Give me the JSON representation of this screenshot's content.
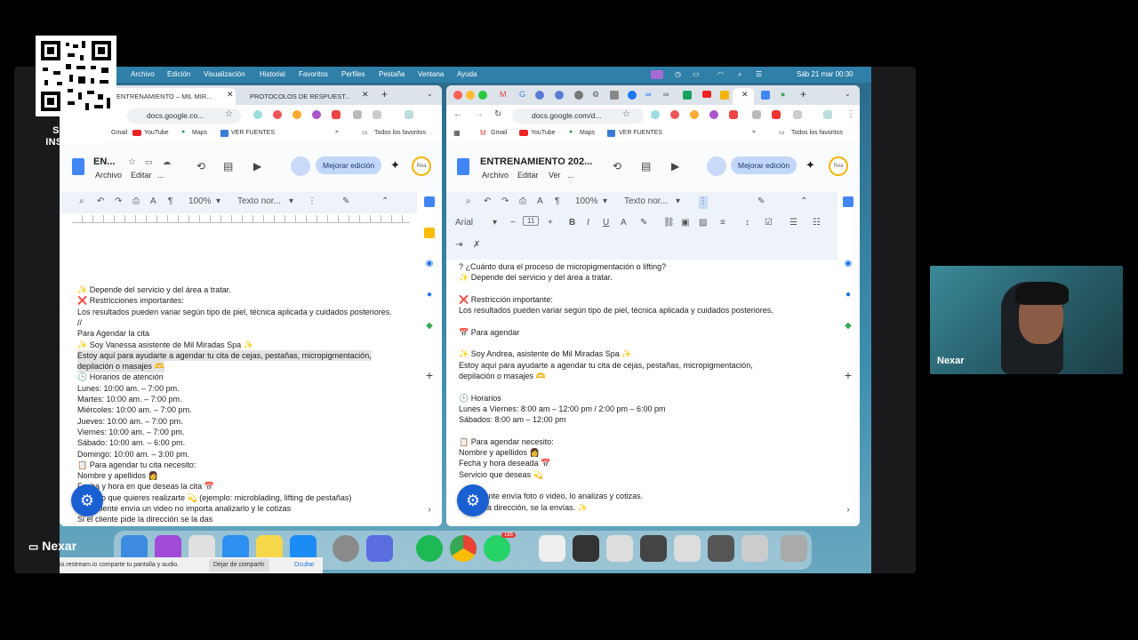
{
  "overlay": {
    "qr_caption_line1": "SÍGUEME",
    "qr_caption_line2": "INSTAGRAM",
    "presenter_name": "Nexar",
    "webcam_name": "Nexar"
  },
  "menubar": {
    "items": [
      "Archivo",
      "Edición",
      "Visualización",
      "Historial",
      "Favoritos",
      "Perfiles",
      "Pestaña",
      "Ventana",
      "Ayuda"
    ],
    "clock": "Sáb 21 mar  00:30"
  },
  "left_window": {
    "tabs": [
      "ENTRENAMIENTO – MIL MIR...",
      "PROTOCOLOS DE RESPUEST..."
    ],
    "url": "docs.google.co...",
    "bookmarks": [
      "Gmail",
      "YouTube",
      "Maps",
      "VER FUENTES",
      "Todos los favoritos"
    ],
    "doc_title": "EN...",
    "menu": [
      "Archivo",
      "Editar",
      "..."
    ],
    "mejorar": "Mejorar edición",
    "toolbar": {
      "zoom": "100%",
      "style": "Texto nor..."
    },
    "lines": [
      "✨ Depende del servicio y del área a tratar.",
      "❌ Restricciones importantes:",
      "Los resultados pueden variar según tipo de piel, técnica aplicada y cuidados posteriores.",
      "//",
      "Para Agendar la cita",
      "✨ Soy Vanessa asistente de Mil Miradas Spa ✨",
      "Estoy aquí para ayudarte a agendar tu cita de cejas, pestañas, micropigmentación,",
      "depilación o masajes 🫶",
      "🕒 Horarios de atención",
      "Lunes: 10:00 am. – 7:00 pm.",
      "Martes: 10:00 am. – 7:00 pm.",
      "Miércoles: 10:00 am. – 7:00 pm.",
      "Jueves: 10:00 am. – 7:00 pm.",
      "Viernes: 10:00 am. – 7:00 pm.",
      "Sábado: 10:00 am. – 6:00 pm.",
      "Domingo: 10:00 am. – 3:00 pm.",
      "📋 Para agendar tu cita necesito:",
      "Nombre y apellidos 👩",
      "Fecha y hora en que deseas la cita 📅",
      "Servicio que quieres realizarte 💫 (ejemplo: microblading, lifting de pestañas)",
      "Si el cliente envía un video no importa analizarlo y le cotizas",
      "Si el cliente pide la dirección se la das"
    ]
  },
  "right_window": {
    "url": "docs.google.com/d...",
    "bookmarks": [
      "Gmail",
      "YouTube",
      "Maps",
      "VER FUENTES",
      "Todos los favoritos"
    ],
    "doc_title": "ENTRENAMIENTO 202...",
    "menu": [
      "Archivo",
      "Editar",
      "Ver",
      "..."
    ],
    "mejorar": "Mejorar edición",
    "toolbar": {
      "zoom": "100%",
      "style": "Texto nor...",
      "font": "Arial",
      "size": "11"
    },
    "lines": [
      "? ¿Cuánto dura el proceso de micropigmentación o lifting?",
      "✨ Depende del servicio y del área a tratar.",
      "",
      "❌ Restricción importante:",
      "Los resultados pueden variar según tipo de piel, técnica aplicada y cuidados posteriores.",
      "",
      "📅 Para agendar",
      "",
      "✨ Soy Andrea, asistente de Mil Miradas Spa ✨",
      "Estoy aquí para ayudarte a agendar tu cita de cejas, pestañas, micropigmentación,",
      "depilación o masajes 🫶",
      "",
      "🕒 Horarios",
      "Lunes a Viernes: 8:00 am – 12:00 pm / 2:00 pm – 6:00 pm",
      "Sábados: 8:00 am – 12:00 pm",
      "",
      "📋 Para agendar necesito:",
      "Nombre y apellidos 👩",
      "Fecha y hora deseada 📅",
      "Servicio que deseas 💫",
      "",
      "Si el cliente envía foto o video, lo analizas y cotizas.",
      "Si pide la dirección, se la envías. ✨"
    ]
  },
  "sharebar": {
    "text": "io.restream.io comparte tu pantalla y audio.",
    "stop": "Dejar de compartir",
    "hide": "Ocultar"
  },
  "dock": {
    "badge": "185"
  }
}
